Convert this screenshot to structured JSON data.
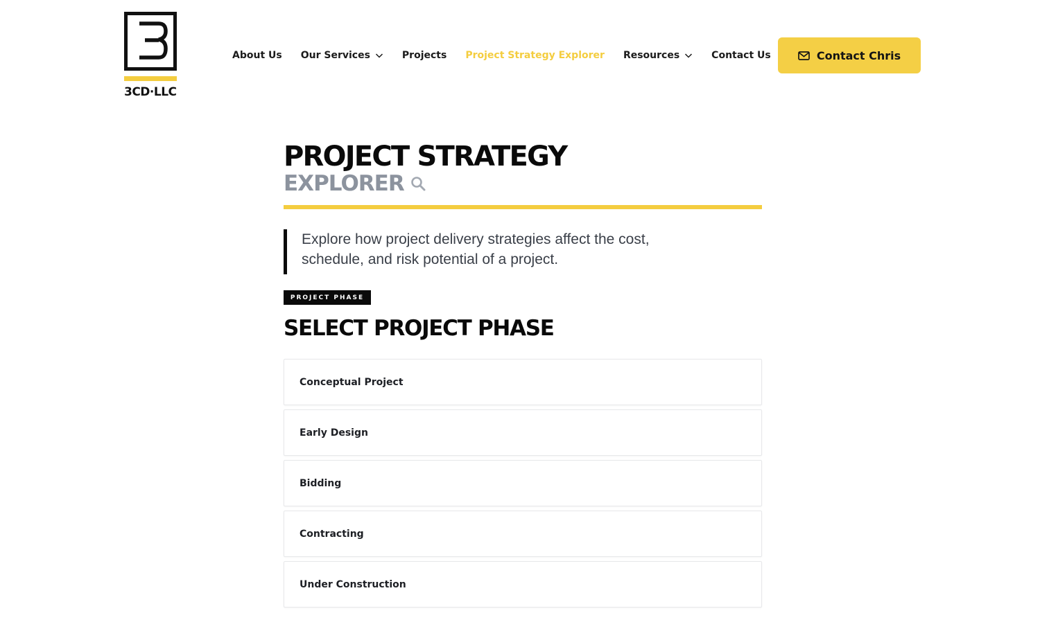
{
  "brand": {
    "logo_text": "3CD·LLC",
    "accent_color": "#f4cd3f"
  },
  "nav": {
    "items": [
      {
        "label": "About Us",
        "has_dropdown": false,
        "active": false
      },
      {
        "label": "Our Services",
        "has_dropdown": true,
        "active": false
      },
      {
        "label": "Projects",
        "has_dropdown": false,
        "active": false
      },
      {
        "label": "Project Strategy Explorer",
        "has_dropdown": false,
        "active": true
      },
      {
        "label": "Resources",
        "has_dropdown": true,
        "active": false
      },
      {
        "label": "Contact Us",
        "has_dropdown": false,
        "active": false
      }
    ]
  },
  "cta": {
    "label": "Contact Chris",
    "icon": "mail-icon"
  },
  "page": {
    "title_line1": "PROJECT STRATEGY",
    "title_line2": "EXPLORER",
    "title_icon": "search-icon",
    "intro": "Explore how project delivery strategies affect the cost, schedule, and risk potential of a project."
  },
  "phase": {
    "badge": "PROJECT PHASE",
    "heading": "SELECT PROJECT PHASE",
    "options": [
      {
        "label": "Conceptual Project"
      },
      {
        "label": "Early Design"
      },
      {
        "label": "Bidding"
      },
      {
        "label": "Contracting"
      },
      {
        "label": "Under Construction"
      }
    ]
  }
}
